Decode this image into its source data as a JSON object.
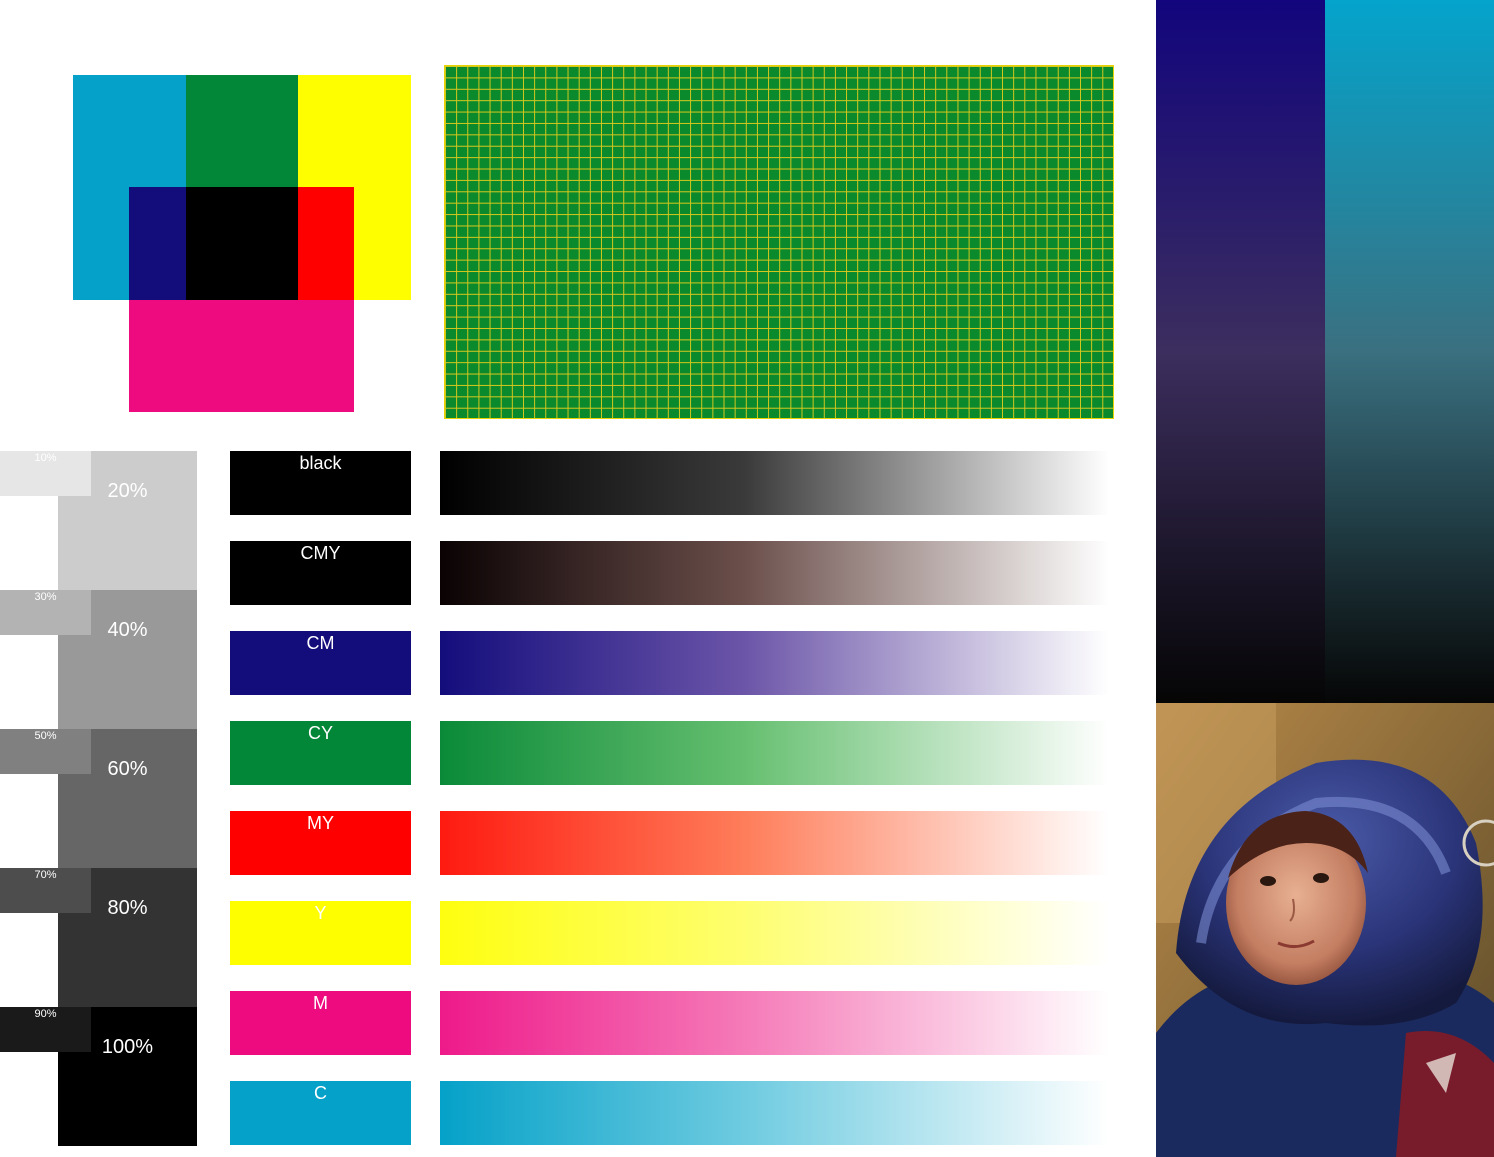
{
  "colors": {
    "cyan": "#05a1c8",
    "green": "#028637",
    "yellow": "#fefe00",
    "navy": "#130d7c",
    "black": "#000000",
    "red": "#fe0000",
    "magenta": "#ee0a7f",
    "grid_green": "#0a8a2c",
    "grid_line": "#d6c81e"
  },
  "gray_steps": [
    {
      "small_label": "10%",
      "big_label": "20%",
      "small_color": "#e6e6e6",
      "big_color": "#cccccc"
    },
    {
      "small_label": "30%",
      "big_label": "40%",
      "small_color": "#b3b3b3",
      "big_color": "#999999"
    },
    {
      "small_label": "50%",
      "big_label": "60%",
      "small_color": "#808080",
      "big_color": "#666666"
    },
    {
      "small_label": "70%",
      "big_label": "80%",
      "small_color": "#4d4d4d",
      "big_color": "#333333"
    },
    {
      "small_label": "90%",
      "big_label": "100%",
      "small_color": "#1a1a1a",
      "big_color": "#000000"
    }
  ],
  "color_rows": [
    {
      "label": "black",
      "swatch": "#000000",
      "ramp_start": "#000000",
      "ramp_mid": "#3a3a3a"
    },
    {
      "label": "CMY",
      "swatch": "#000000",
      "ramp_start": "#0a0203",
      "ramp_mid": "#6b4f4b"
    },
    {
      "label": "CM",
      "swatch": "#130d7c",
      "ramp_start": "#130d7c",
      "ramp_mid": "#6b55a8"
    },
    {
      "label": "CY",
      "swatch": "#028637",
      "ramp_start": "#0a8a38",
      "ramp_mid": "#66bf70"
    },
    {
      "label": "MY",
      "swatch": "#fe0000",
      "ramp_start": "#fe1a10",
      "ramp_mid": "#fe7d5a"
    },
    {
      "label": "Y",
      "swatch": "#fefe00",
      "ramp_start": "#fefe10",
      "ramp_mid": "#fefe70"
    },
    {
      "label": "M",
      "swatch": "#ee0a7f",
      "ramp_start": "#ee1a8a",
      "ramp_mid": "#f57ab8"
    },
    {
      "label": "C",
      "swatch": "#05a1c8",
      "ramp_start": "#05a1c8",
      "ramp_mid": "#6ecbe0"
    }
  ],
  "vertical_gradients": {
    "left": {
      "top": "#12057d",
      "mid": "#3c2e5e",
      "bottom": "#050505"
    },
    "right": {
      "top": "#04a4cc",
      "mid": "#3a7080",
      "bottom": "#060606"
    }
  }
}
